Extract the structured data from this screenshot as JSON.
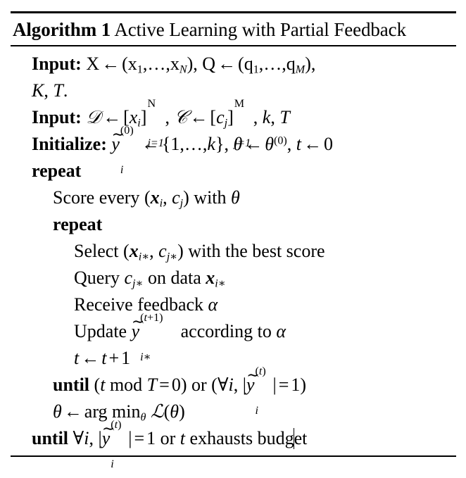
{
  "document": {
    "type": "algorithm-float",
    "background_color": "#ffffff",
    "text_color": "#000000"
  },
  "algorithm": {
    "title": {
      "keyword": "Algorithm 1",
      "name": "Active Learning with Partial Feedback"
    },
    "rules": {
      "top": "thick",
      "mid": "thin",
      "bottom": "thin"
    },
    "lines": [
      {
        "id": "input-1",
        "indent": 0,
        "keyword": "Input:",
        "text": "X ← (x₁, … , x_N), Q ← (q₁, … , q_M),",
        "plain": "Input: X <- (x_1,...,x_N), Q <- (q_1,...,q_M),"
      },
      {
        "id": "input-1-cont",
        "indent": 0,
        "keyword": "",
        "text": "K, T.",
        "plain": "K, T."
      },
      {
        "id": "input-2",
        "indent": 0,
        "keyword": "Input:",
        "text": "𝒟 ← [x_i]_{i=1}^{N}, 𝒞 ← [c_j]_{j=1}^{M}, k, T",
        "plain": "Input: D <- [x_i]_{i=1}^N, C <- [c_j]_{j=1}^M, k, T"
      },
      {
        "id": "initialize",
        "indent": 0,
        "keyword": "Initialize:",
        "text": "ỹ_i^{(0)} ← {1, … , k}, θ ← θ^{(0)}, t ← 0",
        "plain": "Initialize: y~_i^(0) <- {1,...,k}, theta <- theta^(0), t <- 0"
      },
      {
        "id": "repeat-outer",
        "indent": 0,
        "keyword": "repeat",
        "text": "",
        "plain": "repeat"
      },
      {
        "id": "score",
        "indent": 1,
        "keyword": "",
        "text": "Score every (x_i, c_j) with θ",
        "plain": "Score every (x_i, c_j) with theta"
      },
      {
        "id": "repeat-inner",
        "indent": 1,
        "keyword": "repeat",
        "text": "",
        "plain": "repeat"
      },
      {
        "id": "select",
        "indent": 2,
        "keyword": "",
        "text": "Select (x_{i*}, c_{j*}) with the best score",
        "plain": "Select (x_{i*}, c_{j*}) with the best score"
      },
      {
        "id": "query",
        "indent": 2,
        "keyword": "",
        "text": "Query c_{j*} on data x_{i*}",
        "plain": "Query c_{j*} on data x_{i*}"
      },
      {
        "id": "receive",
        "indent": 2,
        "keyword": "",
        "text": "Receive feedback α",
        "plain": "Receive feedback alpha"
      },
      {
        "id": "update",
        "indent": 2,
        "keyword": "",
        "text": "Update ỹ_{i*}^{(t+1)} according to α",
        "plain": "Update y~_{i*}^(t+1) according to alpha"
      },
      {
        "id": "increment-t",
        "indent": 2,
        "keyword": "",
        "text": "t ← t + 1",
        "plain": "t <- t + 1"
      },
      {
        "id": "until-inner",
        "indent": 1,
        "keyword": "until",
        "text": "(t mod T = 0) or (∀i, |ỹ_i^{(t)}| = 1)",
        "plain": "until (t mod T = 0) or (forall i, |y~_i^(t)| = 1)"
      },
      {
        "id": "theta-update",
        "indent": 1,
        "keyword": "",
        "text": "θ ← arg min_θ ℒ(θ)",
        "plain": "theta <- arg min_theta L(theta)"
      },
      {
        "id": "until-outer",
        "indent": 0,
        "keyword": "until",
        "text": "∀i, |ỹ_i^{(t)}| = 1 or t exhausts budget",
        "plain": "until forall i, |y~_i^(t)| = 1 or t exhausts budget"
      }
    ],
    "tokens": {
      "input_label": "Input:",
      "initialize_label": "Initialize:",
      "repeat_label": "repeat",
      "until_label": "until",
      "leftarrow": "←",
      "forall": "∀",
      "theta": "θ",
      "alpha": "α",
      "dots": "…",
      "X": "X",
      "Q": "Q",
      "K": "K",
      "T": "T",
      "k": "k",
      "t": "t",
      "N": "N",
      "M": "M",
      "x": "x",
      "q": "q",
      "c": "c",
      "i": "i",
      "j": "j",
      "D_cal": "𝒟",
      "C_cal": "𝒞",
      "L_cal": "ℒ",
      "star": "∗",
      "mod": "mod",
      "argmin": "arg min",
      "zero": "0",
      "one": "1",
      "eq": "=",
      "plus": "+",
      "comma": ",",
      "period": ".",
      "bar": "|",
      "lparen": "(",
      "rparen": ")",
      "lbrack": "[",
      "rbrack": "]",
      "lbrace": "{",
      "rbrace": "}",
      "score_every": "Score every",
      "with": "with",
      "select": "Select",
      "with_best_score": "with the best score",
      "query": "Query",
      "on_data": "on data",
      "receive_feedback": "Receive feedback",
      "update": "Update",
      "according_to": "according to",
      "or": "or",
      "exhausts_budget": "exhausts budget",
      "tilde": "∼"
    },
    "caret": {
      "present": true,
      "located_in_word": "budget",
      "after_characters": "budg"
    }
  }
}
